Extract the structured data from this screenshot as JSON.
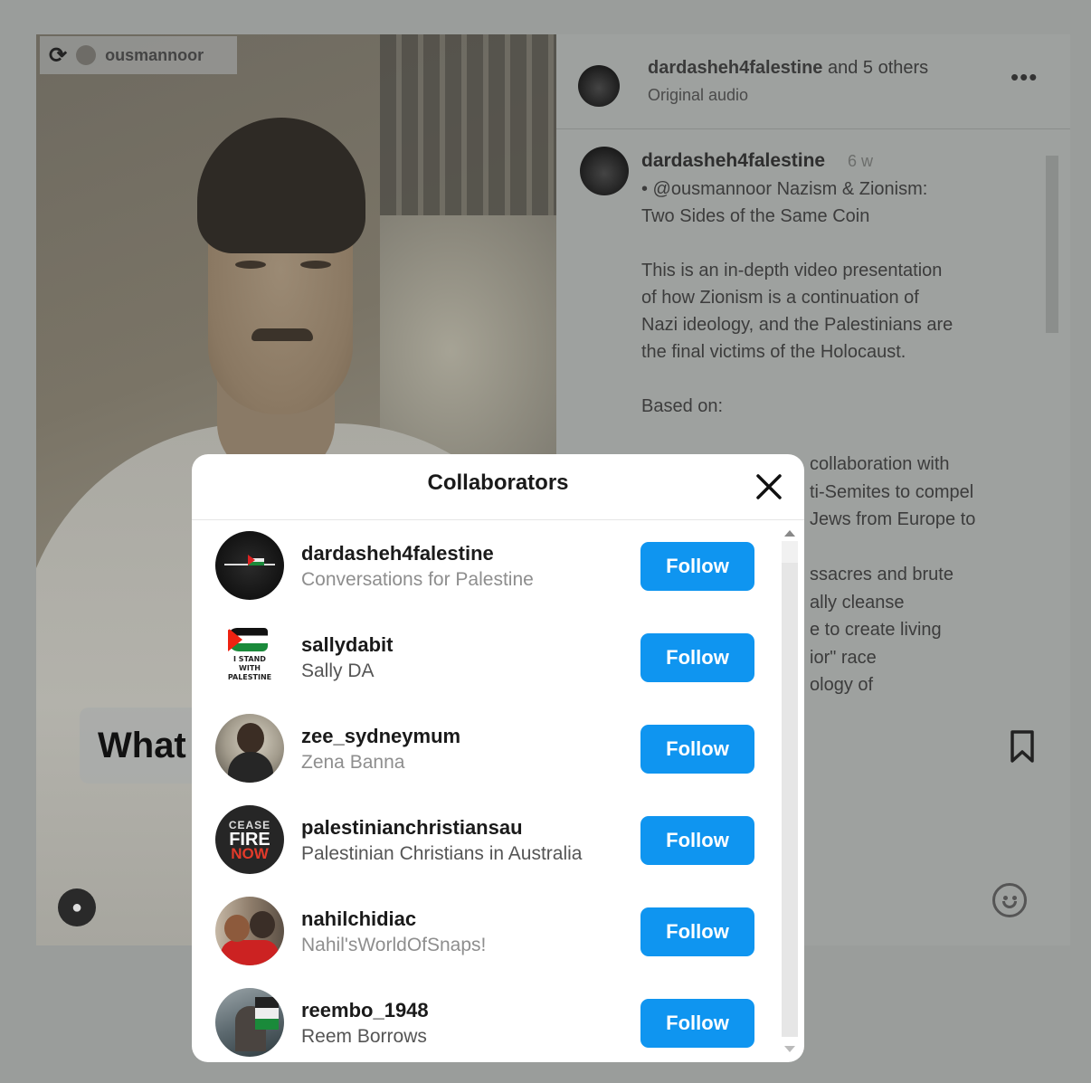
{
  "video": {
    "top_username": "ousmannoor",
    "caption_text": "What"
  },
  "post_header": {
    "title_user": "dardasheh4falestine",
    "title_rest": " and 5 others",
    "subtitle": "Original audio",
    "more_icon": "more-dots-icon",
    "more_label": "•••"
  },
  "post": {
    "author": "dardasheh4falestine",
    "time": "6 w",
    "paragraphs": [
      "• @ousmannoor Nazism & Zionism:\nTwo Sides of the Same Coin",
      "This is an in-depth video presentation\nof how Zionism is a continuation of\nNazi ideology, and the Palestinians are\nthe final victims of the Holocaust.",
      "Based on:"
    ],
    "hidden_lines": [
      "collaboration with",
      "ti-Semites to compel",
      "Jews from Europe to",
      "",
      "ssacres and brute",
      "ally cleanse",
      "e to create living",
      "ior\" race",
      "ology of"
    ]
  },
  "modal": {
    "title": "Collaborators",
    "close_icon": "close-icon",
    "collaborators": [
      {
        "username": "dardasheh4falestine",
        "full_name": "Conversations for Palestine",
        "follow_label": "Follow"
      },
      {
        "username": "sallydabit",
        "full_name": "Sally DA",
        "follow_label": "Follow",
        "avatar_text": "I STAND\nWITH\nPALESTINE"
      },
      {
        "username": "zee_sydneymum",
        "full_name": "Zena Banna",
        "follow_label": "Follow"
      },
      {
        "username": "palestinianchristiansau",
        "full_name": "Palestinian Christians in Australia",
        "follow_label": "Follow",
        "avatar_text": [
          "CEASE",
          "FIRE",
          "NOW"
        ]
      },
      {
        "username": "nahilchidiac",
        "full_name": "Nahil'sWorldOfSnaps!",
        "follow_label": "Follow"
      },
      {
        "username": "reembo_1948",
        "full_name": "Reem Borrows",
        "follow_label": "Follow"
      }
    ]
  },
  "colors": {
    "follow_button": "#0f95f0",
    "overlay": "#9a9d9b",
    "modal_bg": "#ffffff"
  }
}
